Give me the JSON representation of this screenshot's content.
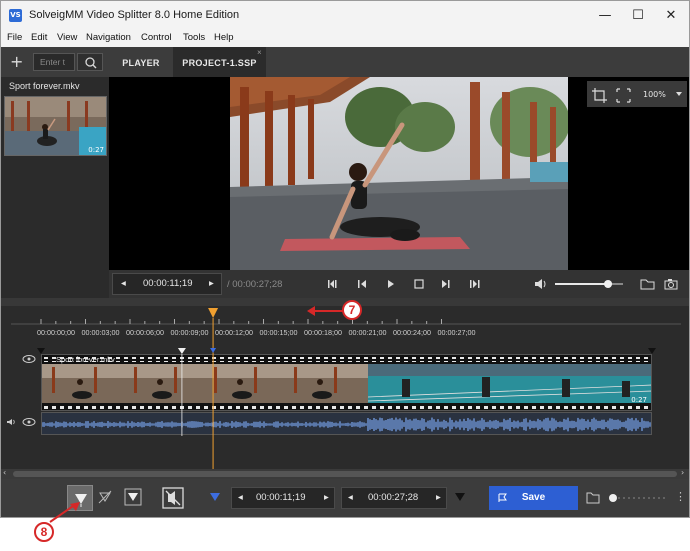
{
  "window": {
    "title": "SolveigMM Video Splitter 8.0 Home Edition",
    "app_icon_text": "VS",
    "minimize": "—",
    "maximize": "☐",
    "close": "✕"
  },
  "menu": [
    "File",
    "Edit",
    "View",
    "Navigation",
    "Control",
    "Tools",
    "Help"
  ],
  "tabbar": {
    "add_label": "+",
    "search_placeholder": "Enter t",
    "tabs": [
      {
        "label": "PLAYER"
      },
      {
        "label": "PROJECT-1.SSP",
        "close": "×"
      }
    ]
  },
  "library": {
    "file_name": "Sport forever.mkv",
    "thumb_duration": "0:27"
  },
  "player": {
    "zoom": "100%",
    "current_time": "00:00:11;19",
    "total_time": "/ 00:00:27;28",
    "volume_fraction": 0.78
  },
  "timeline": {
    "ruler_labels": [
      "00:00:00;00",
      "00:00:03;00",
      "00:00:06;00",
      "00:00:09;00",
      "00:00:12;00",
      "00:00:15;00",
      "00:00:18;00",
      "00:00:21;00",
      "00:00:24;00",
      "00:00:27;00"
    ],
    "track_name": "Sport forever.mkv",
    "track_duration": "0:27",
    "cursor_time_seconds": 11.6
  },
  "bottom": {
    "marker_in_time": "00:00:11;19",
    "marker_out_time": "00:00:27;28",
    "save_label": "Save"
  },
  "annotations": {
    "seven": "7",
    "eight": "8"
  },
  "colors": {
    "accent": "#2d5fd3",
    "cursor": "#f0a030",
    "annotation": "#d62828",
    "teal_track": "#2a8f9a"
  }
}
